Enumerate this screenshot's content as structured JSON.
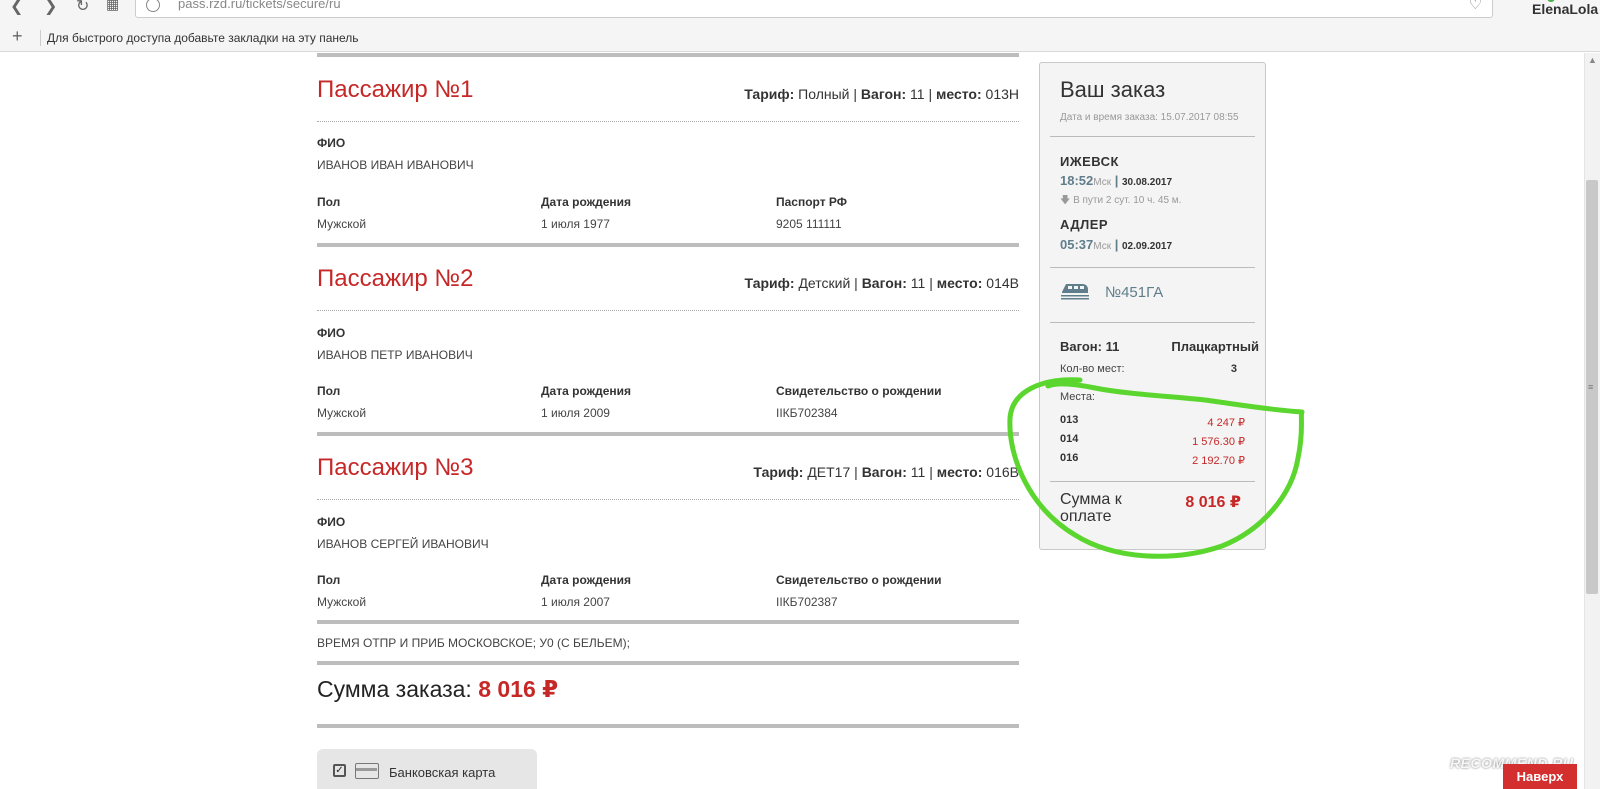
{
  "browser": {
    "url": "pass.rzd.ru/tickets/secure/ru",
    "bookmarks_hint": "Для быстрого доступа добавьте закладки на эту панель",
    "profile_name": "ElenaLola"
  },
  "passengers": [
    {
      "title": "Пассажир №1",
      "tariff_label": "Тариф:",
      "tariff": "Полный",
      "wagon_label": "Вагон:",
      "wagon": "11",
      "seat_label": "место:",
      "seat": "013Н",
      "fio_label": "ФИО",
      "fio": "ИВАНОВ ИВАН ИВАНОВИЧ",
      "sex_label": "Пол",
      "sex": "Мужской",
      "dob_label": "Дата рождения",
      "dob": "1 июля 1977",
      "doc_label": "Паспорт РФ",
      "doc": "9205 111111"
    },
    {
      "title": "Пассажир №2",
      "tariff_label": "Тариф:",
      "tariff": "Детский",
      "wagon_label": "Вагон:",
      "wagon": "11",
      "seat_label": "место:",
      "seat": "014В",
      "fio_label": "ФИО",
      "fio": "ИВАНОВ ПЕТР ИВАНОВИЧ",
      "sex_label": "Пол",
      "sex": "Мужской",
      "dob_label": "Дата рождения",
      "dob": "1 июля 2009",
      "doc_label": "Свидетельство о рождении",
      "doc": "IIКБ702384"
    },
    {
      "title": "Пассажир №3",
      "tariff_label": "Тариф:",
      "tariff": "ДЕТ17",
      "wagon_label": "Вагон:",
      "wagon": "11",
      "seat_label": "место:",
      "seat": "016В",
      "fio_label": "ФИО",
      "fio": "ИВАНОВ СЕРГЕЙ ИВАНОВИЧ",
      "sex_label": "Пол",
      "sex": "Мужской",
      "dob_label": "Дата рождения",
      "dob": "1 июля 2007",
      "doc_label": "Свидетельство о рождении",
      "doc": "IIКБ702387"
    }
  ],
  "note": "ВРЕМЯ ОТПР И ПРИБ МОСКОВСКОЕ; У0 (С БЕЛЬЕМ);",
  "total": {
    "label": "Сумма заказа:",
    "value": "8 016 ₽"
  },
  "payment": {
    "method_label": "Банковская карта"
  },
  "order": {
    "title": "Ваш заказ",
    "date_label": "Дата и время заказа: 15.07.2017 08:55",
    "from_city": "ИЖЕВСК",
    "from_time": "18:52",
    "from_tz": "Мск",
    "from_date": "30.08.2017",
    "duration": "В пути 2 сут. 10 ч. 45 м.",
    "to_city": "АДЛЕР",
    "to_time": "05:37",
    "to_tz": "Мск",
    "to_date": "02.09.2017",
    "train": "№451ГА",
    "wagon": "Вагон: 11",
    "wagon_type": "Плацкартный",
    "seats_count_label": "Кол-во мест:",
    "seats_count": "3",
    "places_label": "Места:",
    "places": [
      {
        "num": "013",
        "price": "4 247 ₽"
      },
      {
        "num": "014",
        "price": "1 576.30 ₽"
      },
      {
        "num": "016",
        "price": "2 192.70 ₽"
      }
    ],
    "sum_label": "Сумма к оплате",
    "sum_value": "8 016 ₽"
  },
  "watermark": "RECOMMEND.RU",
  "to_top": "Наверх",
  "colors": {
    "accent": "#c62828",
    "highlight_marker": "#5bd62e",
    "time": "#607d8b"
  }
}
